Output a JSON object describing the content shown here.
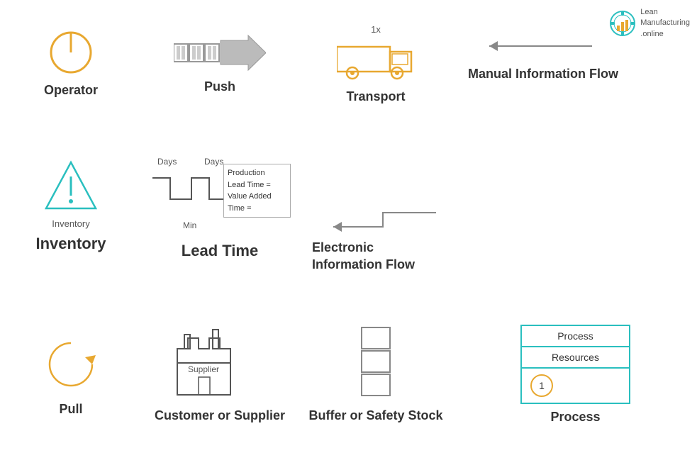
{
  "logo": {
    "brand": "Lean Manufacturing .online",
    "line1": "Lean",
    "line2": "Manufacturing",
    "line3": ".online"
  },
  "row1": {
    "operator": {
      "label": "Operator",
      "icon": "operator-icon"
    },
    "push": {
      "label": "Push",
      "icon": "push-icon"
    },
    "transport": {
      "label": "Transport",
      "count": "1x",
      "icon": "transport-icon"
    },
    "manual_flow": {
      "label": "Manual Information Flow",
      "icon": "manual-flow-icon"
    }
  },
  "row2": {
    "inventory": {
      "label": "Inventory",
      "icon": "inventory-icon"
    },
    "lead_time": {
      "label": "Lead Time",
      "days1": "Days",
      "days2": "Days",
      "min": "Min",
      "box_line1": "Production",
      "box_line2": "Lead Time =",
      "box_line3": "Value Added",
      "box_line4": "Time =",
      "icon": "lead-time-icon"
    },
    "electronic_flow": {
      "label": "Electronic Information Flow",
      "icon": "electronic-flow-icon"
    }
  },
  "row3": {
    "pull": {
      "label": "Pull",
      "icon": "pull-icon"
    },
    "supplier": {
      "label": "Customer or Supplier",
      "box_text": "Supplier",
      "icon": "supplier-icon"
    },
    "buffer": {
      "label": "Buffer or Safety Stock",
      "icon": "buffer-icon"
    },
    "process": {
      "label": "Process",
      "top_text": "Process",
      "mid_text": "Resources",
      "circle_num": "1",
      "icon": "process-icon"
    }
  }
}
